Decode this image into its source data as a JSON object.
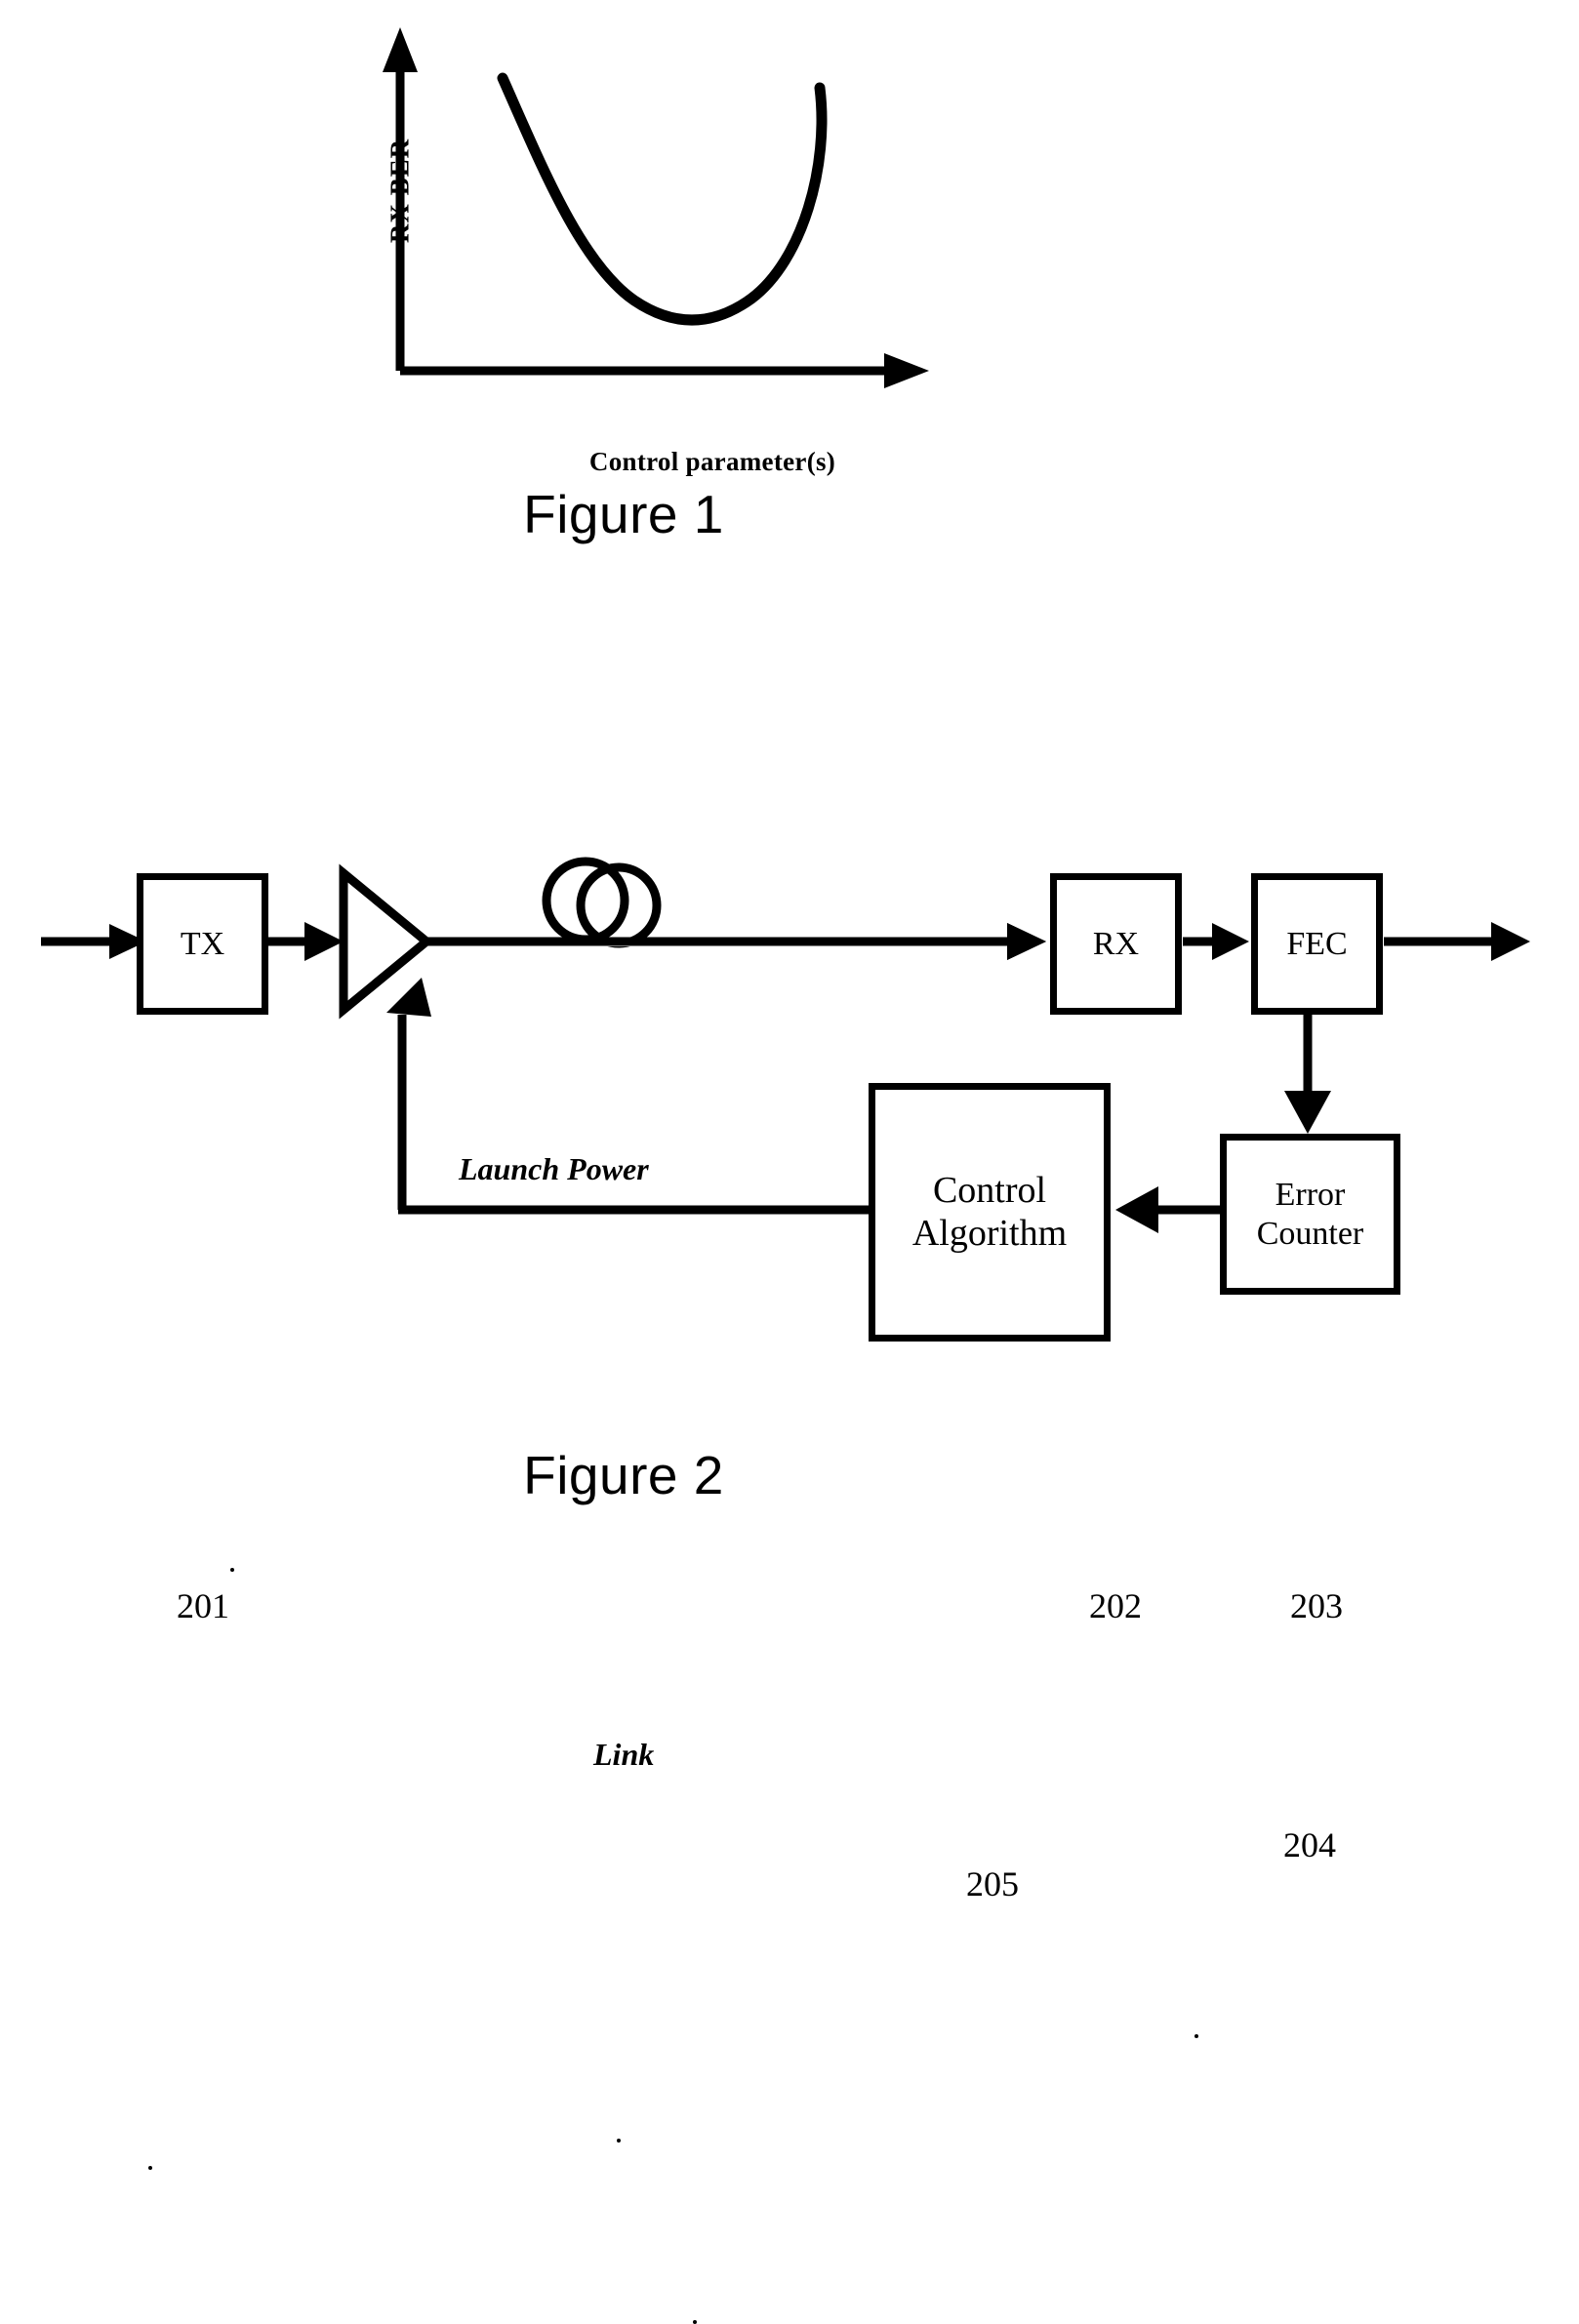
{
  "document": {
    "type": "patent-figure-sheet",
    "background_color": "#ffffff",
    "ink_color": "#000000"
  },
  "figure1": {
    "caption": "Figure 1",
    "y_axis_label": "RX BER",
    "x_axis_label": "Control parameter(s)"
  },
  "chart_data": {
    "type": "line",
    "title": "Figure 1",
    "xlabel": "Control parameter(s)",
    "ylabel": "RX BER",
    "grid": false,
    "legend": null,
    "axis_style": "arrow-tipped L axes, no tick marks, no tick labels",
    "series": [
      {
        "name": "RX BER vs control parameter",
        "shape": "U-shaped convex curve with single minimum",
        "x": [
          0.22,
          0.3,
          0.38,
          0.46,
          0.54,
          0.58,
          0.62,
          0.7,
          0.78,
          0.86,
          0.94
        ],
        "y": [
          0.93,
          0.78,
          0.6,
          0.41,
          0.26,
          0.21,
          0.2,
          0.3,
          0.48,
          0.68,
          0.86
        ]
      }
    ],
    "xlim": [
      0,
      1
    ],
    "ylim": [
      0,
      1
    ]
  },
  "figure2": {
    "caption": "Figure 2",
    "blocks": [
      {
        "id": "tx",
        "label": "TX",
        "ref": "201",
        "ref_position": "above"
      },
      {
        "id": "rx",
        "label": "RX",
        "ref": "202",
        "ref_position": "above"
      },
      {
        "id": "fec",
        "label": "FEC",
        "ref": "203",
        "ref_position": "above"
      },
      {
        "id": "error",
        "label": "Error\nCounter",
        "ref": "204",
        "ref_position": "below"
      },
      {
        "id": "control",
        "label": "Control\nAlgorithm",
        "ref": "205",
        "ref_position": "below"
      }
    ],
    "block_labels": {
      "tx": "TX",
      "rx": "RX",
      "fec": "FEC",
      "error_line1": "Error",
      "error_line2": "Counter",
      "control_line1": "Control",
      "control_line2": "Algorithm"
    },
    "ref_numbers": {
      "tx": "201",
      "rx": "202",
      "fec": "203",
      "error_counter": "204",
      "control_algorithm": "205"
    },
    "annotations": {
      "link": "Link",
      "launch_power": "Launch Power"
    },
    "symbols": {
      "amplifier": "triangle-amplifier",
      "fiber_coil": "fiber-coil-loops"
    }
  }
}
